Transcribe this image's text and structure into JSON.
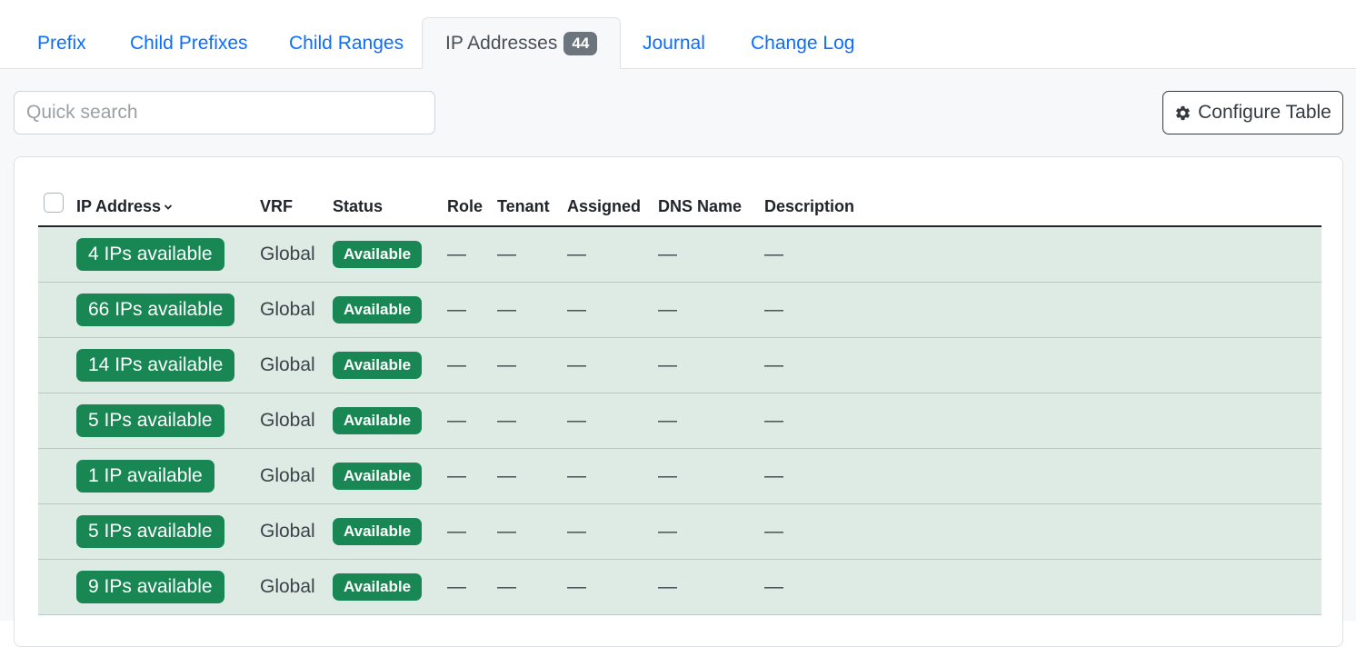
{
  "tabs": {
    "prefix": "Prefix",
    "child_prefixes": "Child Prefixes",
    "child_ranges": "Child Ranges",
    "ip_addresses": "IP Addresses",
    "ip_addresses_count": "44",
    "journal": "Journal",
    "change_log": "Change Log"
  },
  "toolbar": {
    "search_placeholder": "Quick search",
    "configure_label": "Configure Table",
    "configure_icon": "gear-icon"
  },
  "table": {
    "columns": {
      "ip_address": "IP Address",
      "vrf": "VRF",
      "status": "Status",
      "role": "Role",
      "tenant": "Tenant",
      "assigned": "Assigned",
      "dns_name": "DNS Name",
      "description": "Description"
    },
    "rows": [
      {
        "ip": "4 IPs available",
        "vrf": "Global",
        "status": "Available",
        "role": "—",
        "tenant": "—",
        "assigned": "—",
        "dns": "—",
        "description": "—"
      },
      {
        "ip": "66 IPs available",
        "vrf": "Global",
        "status": "Available",
        "role": "—",
        "tenant": "—",
        "assigned": "—",
        "dns": "—",
        "description": "—"
      },
      {
        "ip": "14 IPs available",
        "vrf": "Global",
        "status": "Available",
        "role": "—",
        "tenant": "—",
        "assigned": "—",
        "dns": "—",
        "description": "—"
      },
      {
        "ip": "5 IPs available",
        "vrf": "Global",
        "status": "Available",
        "role": "—",
        "tenant": "—",
        "assigned": "—",
        "dns": "—",
        "description": "—"
      },
      {
        "ip": "1 IP available",
        "vrf": "Global",
        "status": "Available",
        "role": "—",
        "tenant": "—",
        "assigned": "—",
        "dns": "—",
        "description": "—"
      },
      {
        "ip": "5 IPs available",
        "vrf": "Global",
        "status": "Available",
        "role": "—",
        "tenant": "—",
        "assigned": "—",
        "dns": "—",
        "description": "—"
      },
      {
        "ip": "9 IPs available",
        "vrf": "Global",
        "status": "Available",
        "role": "—",
        "tenant": "—",
        "assigned": "—",
        "dns": "—",
        "description": "—"
      }
    ]
  },
  "colors": {
    "link": "#0d6efd",
    "success": "#198754",
    "row_highlight": "#ddebe4",
    "badge_gray": "#6c757d"
  }
}
